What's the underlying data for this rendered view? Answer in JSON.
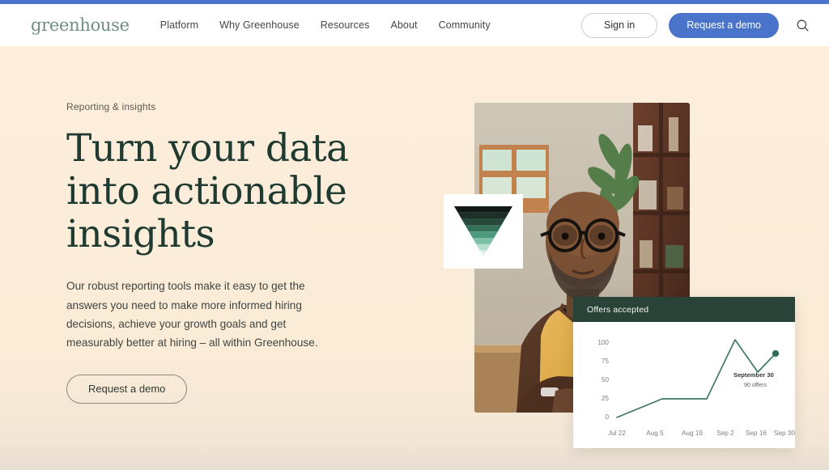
{
  "theme": {
    "accent_bar_color": "#4a74c9",
    "hero_background": "#fbecd8",
    "brand_green": "#2a4338",
    "headline_color": "#1f3a30",
    "button_blue": "#4a74c9",
    "leaf_art_color": "#e0b165",
    "chart_line_color": "#3f7a63"
  },
  "nav": {
    "logo_text": "greenhouse",
    "links": [
      {
        "label": "Platform"
      },
      {
        "label": "Why Greenhouse"
      },
      {
        "label": "Resources"
      },
      {
        "label": "About"
      },
      {
        "label": "Community"
      }
    ],
    "sign_in_label": "Sign in",
    "request_demo_label": "Request a demo",
    "search_icon": "search-icon"
  },
  "hero": {
    "eyebrow": "Reporting & insights",
    "headline_line_1": "Turn your data",
    "headline_line_2": "into actionable",
    "headline_line_3": "insights",
    "body": "Our robust reporting tools make it easy to get the answers you need to make more informed hiring decisions, achieve your growth goals and get measurably better at hiring – all within Greenhouse.",
    "cta_label": "Request a demo",
    "badge_icon": "greenhouse-triangle-logo-icon",
    "photo_alt": "Person with glasses seated at a desk in an office"
  },
  "chart_data": {
    "type": "line",
    "title": "Offers accepted",
    "xlabel": "",
    "ylabel": "",
    "grid": false,
    "legend": false,
    "categories": [
      "Jul 22",
      "Aug 5",
      "Aug 19",
      "Sep 2",
      "Sep 16",
      "Sep 30"
    ],
    "ylim": [
      0,
      110
    ],
    "yticks": [
      0,
      25,
      50,
      75,
      100
    ],
    "ytick_labels": [
      "0",
      "25",
      "50",
      "75",
      "100"
    ],
    "series": [
      {
        "name": "Offers accepted",
        "color": "#3f7a63",
        "x": [
          "Jul 22",
          "Aug 5",
          "Aug 19",
          "Sep 2",
          "Sep 16",
          "Sep 30"
        ],
        "values": [
          2,
          28,
          28,
          103,
          68,
          90
        ]
      }
    ],
    "points": [
      {
        "x": "Jul 22",
        "y": 2
      },
      {
        "x": "Aug 5",
        "y": 28
      },
      {
        "x": "Aug 19",
        "y": 28
      },
      {
        "x": "Sep 2",
        "y": 103
      },
      {
        "x": "Sep 16",
        "y": 68
      },
      {
        "x": "Sep 30",
        "y": 90
      }
    ],
    "marker": {
      "x": "Sep 30",
      "y": 90,
      "color": "#2f6b54"
    },
    "annotation": {
      "title": "September 30",
      "subtitle": "90 offers"
    }
  }
}
